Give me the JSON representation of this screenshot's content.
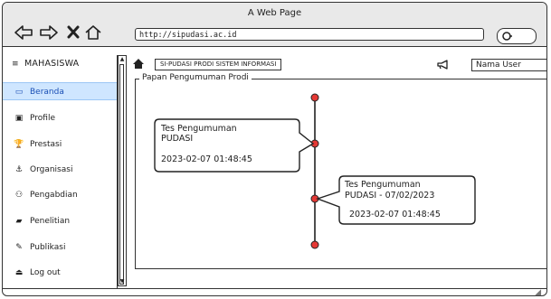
{
  "window": {
    "title": "A Web Page"
  },
  "browser": {
    "url": "http://sipudasi.ac.id",
    "nav_icons": [
      "back-arrow-icon",
      "forward-arrow-icon",
      "close-icon",
      "home-icon"
    ],
    "search_icon": "search-icon"
  },
  "sidebar": {
    "header": "MAHASISWA",
    "items": [
      {
        "label": "Beranda",
        "icon": "▭",
        "active": true
      },
      {
        "label": "Profile",
        "icon": "▣",
        "active": false
      },
      {
        "label": "Prestasi",
        "icon": "🏆",
        "active": false
      },
      {
        "label": "Organisasi",
        "icon": "⚓",
        "active": false
      },
      {
        "label": "Pengabdian",
        "icon": "⚇",
        "active": false
      },
      {
        "label": "Penelitian",
        "icon": "▰",
        "active": false
      },
      {
        "label": "Publikasi",
        "icon": "✎",
        "active": false
      },
      {
        "label": "Log out",
        "icon": "⏏",
        "active": false
      }
    ]
  },
  "topbar": {
    "breadcrumb": "SI-PUDASI PRODI SISTEM INFORMASI",
    "user": "Nama User"
  },
  "panel": {
    "legend": "Papan Pengumuman Prodi",
    "announcements": [
      {
        "line1": "Tes Pengumuman",
        "line2": "PUDASI",
        "timestamp": "2023-02-07 01:48:45"
      },
      {
        "line1": "Tes Pengumuman",
        "line2": "PUDASI - 07/02/2023",
        "timestamp": "2023-02-07 01:48:45"
      }
    ]
  },
  "colors": {
    "active_bg": "#cfe6ff",
    "active_text": "#1a4fb5",
    "marker": "#e53935"
  }
}
